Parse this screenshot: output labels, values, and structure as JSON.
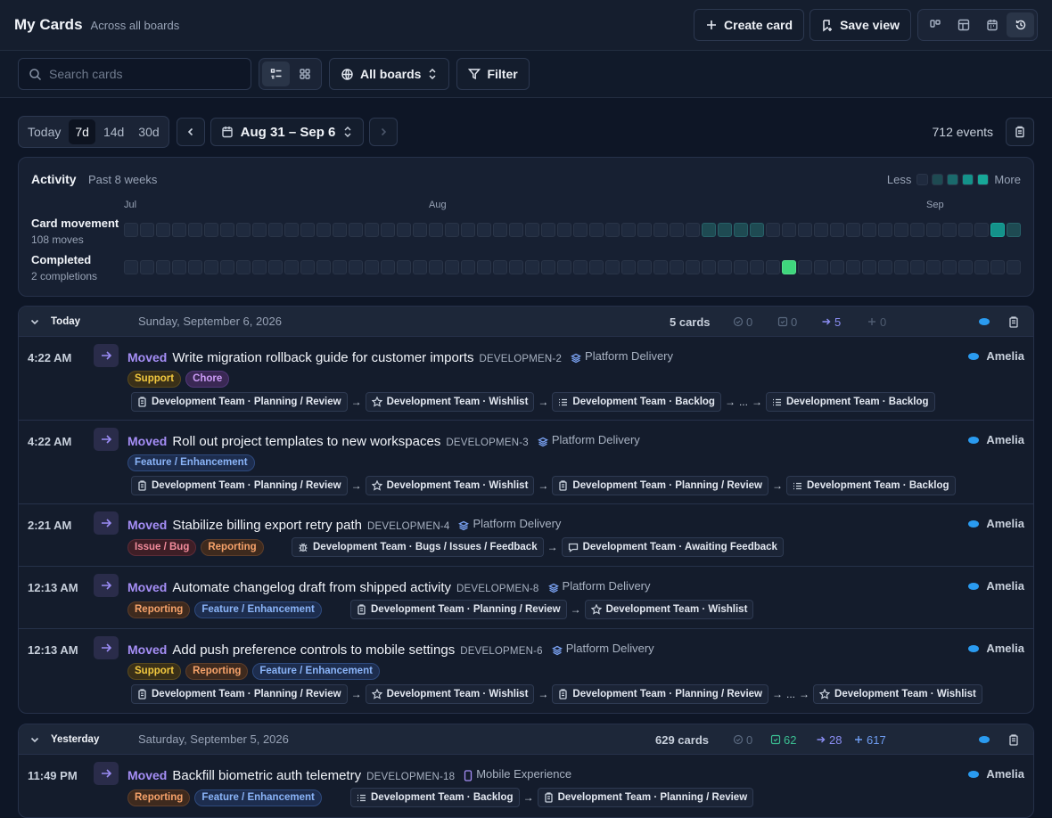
{
  "header": {
    "title": "My Cards",
    "subtitle": "Across all boards",
    "create_label": "Create card",
    "save_label": "Save view"
  },
  "toolbar": {
    "search_placeholder": "Search cards",
    "boards_label": "All boards",
    "filter_label": "Filter"
  },
  "range": {
    "options": [
      "Today",
      "7d",
      "14d",
      "30d"
    ],
    "selected": "7d",
    "label": "Aug 31 – Sep 6",
    "events": "712 events"
  },
  "activity": {
    "title": "Activity",
    "subtitle": "Past 8 weeks",
    "less": "Less",
    "more": "More",
    "months": [
      "Jul",
      "Aug",
      "Sep"
    ],
    "rows": [
      {
        "label": "Card movement",
        "sub": "108 moves",
        "levels": [
          0,
          0,
          0,
          0,
          0,
          0,
          0,
          0,
          0,
          0,
          0,
          0,
          0,
          0,
          0,
          0,
          0,
          0,
          0,
          0,
          0,
          0,
          0,
          0,
          0,
          0,
          0,
          0,
          0,
          0,
          0,
          0,
          0,
          0,
          0,
          0,
          1,
          1,
          1,
          1,
          0,
          0,
          0,
          0,
          0,
          0,
          0,
          0,
          0,
          0,
          0,
          0,
          0,
          0,
          2,
          1
        ]
      },
      {
        "label": "Completed",
        "sub": "2 completions",
        "levels": [
          0,
          0,
          0,
          0,
          0,
          0,
          0,
          0,
          0,
          0,
          0,
          0,
          0,
          0,
          0,
          0,
          0,
          0,
          0,
          0,
          0,
          0,
          0,
          0,
          0,
          0,
          0,
          0,
          0,
          0,
          0,
          0,
          0,
          0,
          0,
          0,
          0,
          0,
          0,
          0,
          0,
          3,
          0,
          0,
          0,
          0,
          0,
          0,
          0,
          0,
          0,
          0,
          0,
          0,
          0,
          0
        ]
      }
    ],
    "colors": {
      "empty": "#1f2a3e",
      "low": "#1e4a52",
      "high": "#14928a",
      "completed": "#3fd67d"
    }
  },
  "groups": [
    {
      "label": "Today",
      "date": "Sunday, September 6, 2026",
      "count": "5 cards",
      "s1": "0",
      "s2": "0",
      "s3": "5",
      "s4": "0",
      "items": [
        {
          "time": "4:22 AM",
          "action": "Moved",
          "title": "Write migration rollback guide for customer imports",
          "id": "DEVELOPMEN-2",
          "board": "Platform Delivery",
          "assignee": "Amelia",
          "tags": [
            {
              "text": "Support",
              "kind": "support"
            },
            {
              "text": "Chore",
              "kind": "chore"
            }
          ],
          "path": [
            {
              "icon": "clipboard",
              "text": "Development Team · Planning / Review"
            },
            {
              "icon": "star",
              "text": "Development Team · Wishlist"
            },
            {
              "icon": "list",
              "text": "Development Team · Backlog"
            },
            {
              "ellipsis": "..."
            },
            {
              "icon": "list",
              "text": "Development Team · Backlog"
            }
          ]
        },
        {
          "time": "4:22 AM",
          "action": "Moved",
          "title": "Roll out project templates to new workspaces",
          "id": "DEVELOPMEN-3",
          "board": "Platform Delivery",
          "assignee": "Amelia",
          "tags": [
            {
              "text": "Feature / Enhancement",
              "kind": "feature"
            }
          ],
          "path": [
            {
              "icon": "clipboard",
              "text": "Development Team · Planning / Review"
            },
            {
              "icon": "star",
              "text": "Development Team · Wishlist"
            },
            {
              "icon": "clipboard",
              "text": "Development Team · Planning / Review"
            },
            {
              "icon": "list",
              "text": "Development Team · Backlog"
            }
          ]
        },
        {
          "time": "2:21 AM",
          "action": "Moved",
          "title": "Stabilize billing export retry path",
          "id": "DEVELOPMEN-4",
          "board": "Platform Delivery",
          "assignee": "Amelia",
          "inline": true,
          "tags": [
            {
              "text": "Issue / Bug",
              "kind": "issue"
            },
            {
              "text": "Reporting",
              "kind": "reporting"
            }
          ],
          "path": [
            {
              "icon": "bug",
              "text": "Development Team · Bugs / Issues / Feedback"
            },
            {
              "icon": "chat",
              "text": "Development Team · Awaiting Feedback"
            }
          ]
        },
        {
          "time": "12:13 AM",
          "action": "Moved",
          "title": "Automate changelog draft from shipped activity",
          "id": "DEVELOPMEN-8",
          "board": "Platform Delivery",
          "assignee": "Amelia",
          "inline": true,
          "tags": [
            {
              "text": "Reporting",
              "kind": "reporting"
            },
            {
              "text": "Feature / Enhancement",
              "kind": "feature"
            }
          ],
          "path": [
            {
              "icon": "clipboard",
              "text": "Development Team · Planning / Review"
            },
            {
              "icon": "star",
              "text": "Development Team · Wishlist"
            }
          ]
        },
        {
          "time": "12:13 AM",
          "action": "Moved",
          "title": "Add push preference controls to mobile settings",
          "id": "DEVELOPMEN-6",
          "board": "Platform Delivery",
          "assignee": "Amelia",
          "tags": [
            {
              "text": "Support",
              "kind": "support"
            },
            {
              "text": "Reporting",
              "kind": "reporting"
            },
            {
              "text": "Feature / Enhancement",
              "kind": "feature"
            }
          ],
          "path": [
            {
              "icon": "clipboard",
              "text": "Development Team · Planning / Review"
            },
            {
              "icon": "star",
              "text": "Development Team · Wishlist"
            },
            {
              "icon": "clipboard",
              "text": "Development Team · Planning / Review"
            },
            {
              "ellipsis": "..."
            },
            {
              "icon": "star",
              "text": "Development Team · Wishlist"
            }
          ]
        }
      ]
    },
    {
      "label": "Yesterday",
      "date": "Saturday, September 5, 2026",
      "count": "629 cards",
      "s1": "0",
      "s2": "62",
      "s3": "28",
      "s4": "617",
      "items": [
        {
          "time": "11:49 PM",
          "action": "Moved",
          "title": "Backfill biometric auth telemetry",
          "id": "DEVELOPMEN-18",
          "board": "Mobile Experience",
          "boardIcon": "phone",
          "assignee": "Amelia",
          "inline": true,
          "tags": [
            {
              "text": "Reporting",
              "kind": "reporting"
            },
            {
              "text": "Feature / Enhancement",
              "kind": "feature"
            }
          ],
          "path": [
            {
              "icon": "list",
              "text": "Development Team · Backlog"
            },
            {
              "icon": "clipboard",
              "text": "Development Team · Planning / Review"
            }
          ]
        }
      ]
    }
  ]
}
